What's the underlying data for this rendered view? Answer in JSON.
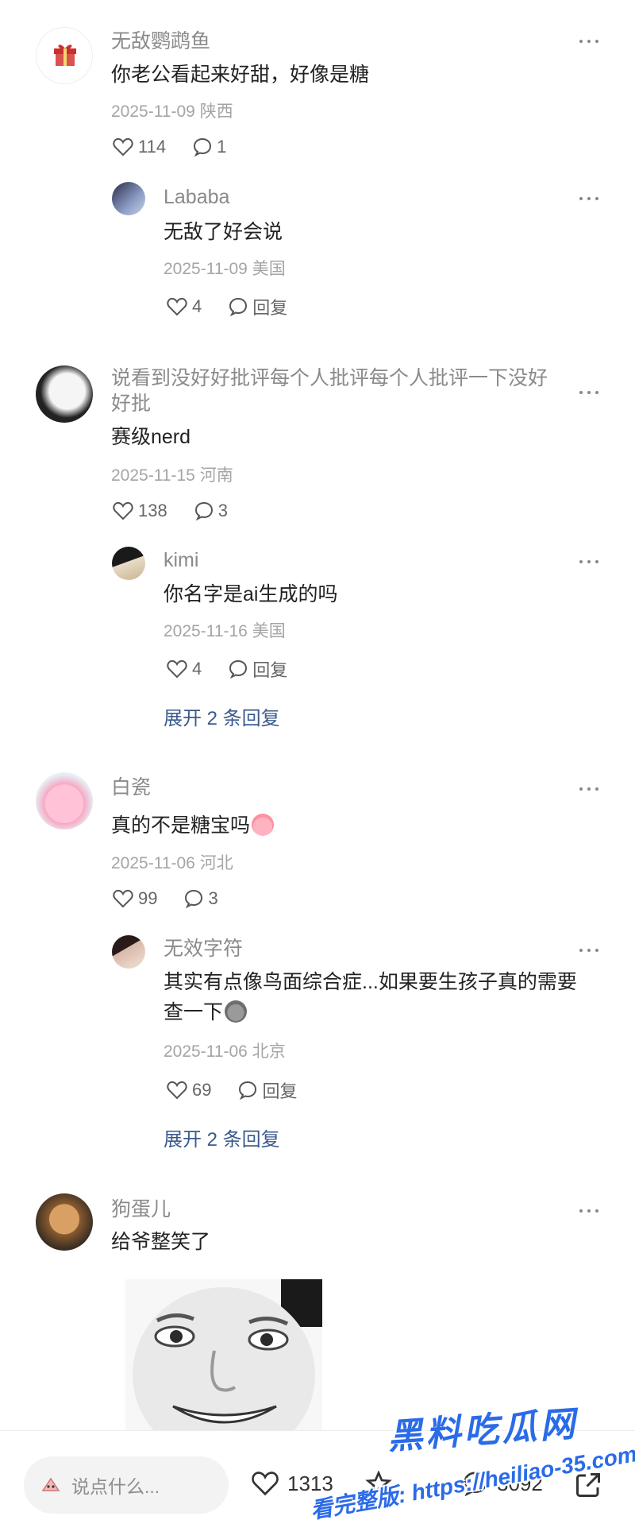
{
  "comments": [
    {
      "username": "无敌鹦鹉鱼",
      "text": "你老公看起来好甜，好像是糖",
      "meta": "2025-11-09 陕西",
      "likes": "114",
      "replies": "1",
      "reply": {
        "username": "Lababa",
        "text": "无敌了好会说",
        "meta": "2025-11-09 美国",
        "likes": "4",
        "reply_label": "回复"
      }
    },
    {
      "username_line1": "说看到没好好批评每个人批评每个人批评一下没好",
      "username_line2": "好批",
      "text": "赛级nerd",
      "meta": "2025-11-15 河南",
      "likes": "138",
      "replies": "3",
      "reply": {
        "username": "kimi",
        "text": "你名字是ai生成的吗",
        "meta": "2025-11-16 美国",
        "likes": "4",
        "reply_label": "回复"
      },
      "expand_label": "展开 2 条回复"
    },
    {
      "username": "白瓷",
      "text": "真的不是糖宝吗",
      "meta": "2025-11-06 河北",
      "likes": "99",
      "replies": "3",
      "reply": {
        "username": "无效字符",
        "text_line1": "其实有点像鸟面综合症...如果要生孩子真的需要",
        "text_line2": "查一下",
        "meta": "2025-11-06 北京",
        "likes": "69",
        "reply_label": "回复"
      },
      "expand_label": "展开 2 条回复"
    },
    {
      "username": "狗蛋儿",
      "text": "给爷整笑了"
    }
  ],
  "bottom_bar": {
    "input_placeholder": "说点什么...",
    "likes": "1313",
    "comments": "3092"
  },
  "watermark": {
    "title": "黑料吃瓜网",
    "url": "看完整版: https://heiliao-35.com"
  },
  "colors": {
    "link": "#3a5a8c",
    "watermark": "#2a6be8"
  }
}
